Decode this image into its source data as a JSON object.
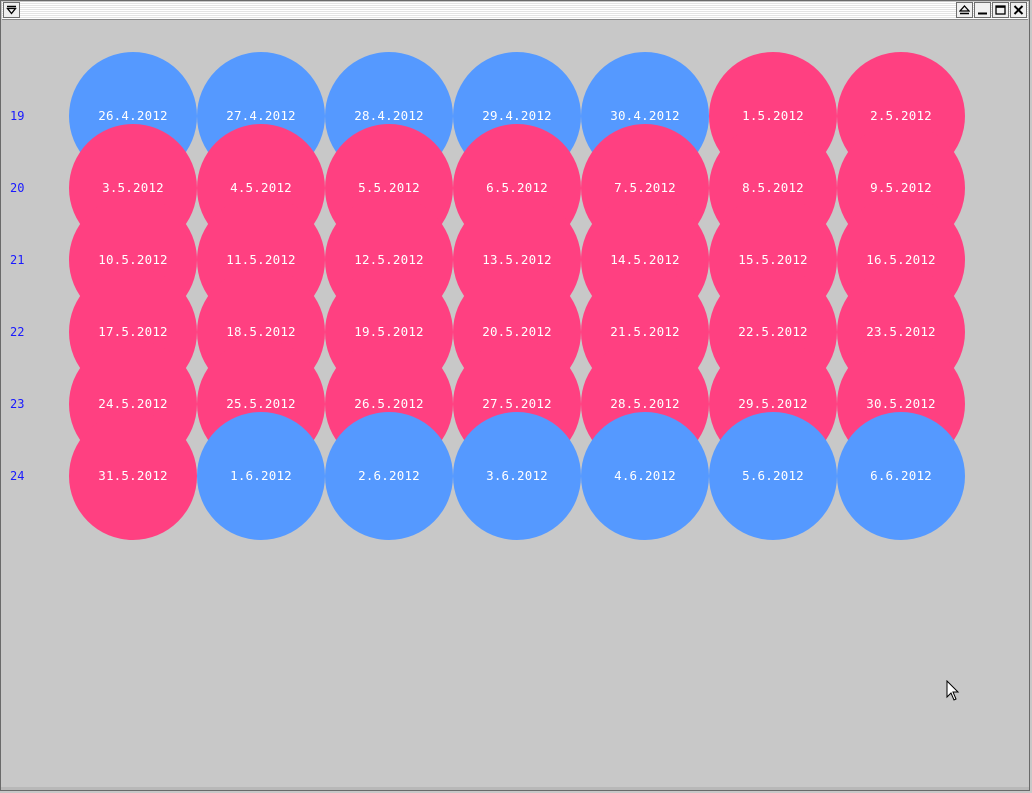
{
  "colors": {
    "workday": "#ff4081",
    "weekend": "#5599ff",
    "week_label": "#1a1aff",
    "background": "#c8c8c8"
  },
  "titlebar": {
    "icons": [
      "window-menu-icon",
      "shade-icon",
      "minimize-icon",
      "maximize-icon",
      "close-icon"
    ]
  },
  "calendar": {
    "weeks": [
      {
        "number": "19",
        "days": [
          {
            "label": "26.4.2012",
            "type": "weekend"
          },
          {
            "label": "27.4.2012",
            "type": "weekend"
          },
          {
            "label": "28.4.2012",
            "type": "weekend"
          },
          {
            "label": "29.4.2012",
            "type": "weekend"
          },
          {
            "label": "30.4.2012",
            "type": "weekend"
          },
          {
            "label": "1.5.2012",
            "type": "workday"
          },
          {
            "label": "2.5.2012",
            "type": "workday"
          }
        ]
      },
      {
        "number": "20",
        "days": [
          {
            "label": "3.5.2012",
            "type": "workday"
          },
          {
            "label": "4.5.2012",
            "type": "workday"
          },
          {
            "label": "5.5.2012",
            "type": "workday"
          },
          {
            "label": "6.5.2012",
            "type": "workday"
          },
          {
            "label": "7.5.2012",
            "type": "workday"
          },
          {
            "label": "8.5.2012",
            "type": "workday"
          },
          {
            "label": "9.5.2012",
            "type": "workday"
          }
        ]
      },
      {
        "number": "21",
        "days": [
          {
            "label": "10.5.2012",
            "type": "workday"
          },
          {
            "label": "11.5.2012",
            "type": "workday"
          },
          {
            "label": "12.5.2012",
            "type": "workday"
          },
          {
            "label": "13.5.2012",
            "type": "workday"
          },
          {
            "label": "14.5.2012",
            "type": "workday"
          },
          {
            "label": "15.5.2012",
            "type": "workday"
          },
          {
            "label": "16.5.2012",
            "type": "workday"
          }
        ]
      },
      {
        "number": "22",
        "days": [
          {
            "label": "17.5.2012",
            "type": "workday"
          },
          {
            "label": "18.5.2012",
            "type": "workday"
          },
          {
            "label": "19.5.2012",
            "type": "workday"
          },
          {
            "label": "20.5.2012",
            "type": "workday"
          },
          {
            "label": "21.5.2012",
            "type": "workday"
          },
          {
            "label": "22.5.2012",
            "type": "workday"
          },
          {
            "label": "23.5.2012",
            "type": "workday"
          }
        ]
      },
      {
        "number": "23",
        "days": [
          {
            "label": "24.5.2012",
            "type": "workday"
          },
          {
            "label": "25.5.2012",
            "type": "workday"
          },
          {
            "label": "26.5.2012",
            "type": "workday"
          },
          {
            "label": "27.5.2012",
            "type": "workday"
          },
          {
            "label": "28.5.2012",
            "type": "workday"
          },
          {
            "label": "29.5.2012",
            "type": "workday"
          },
          {
            "label": "30.5.2012",
            "type": "workday"
          }
        ]
      },
      {
        "number": "24",
        "days": [
          {
            "label": "31.5.2012",
            "type": "workday"
          },
          {
            "label": "1.6.2012",
            "type": "weekend"
          },
          {
            "label": "2.6.2012",
            "type": "weekend"
          },
          {
            "label": "3.6.2012",
            "type": "weekend"
          },
          {
            "label": "4.6.2012",
            "type": "weekend"
          },
          {
            "label": "5.6.2012",
            "type": "weekend"
          },
          {
            "label": "6.6.2012",
            "type": "weekend"
          }
        ]
      }
    ]
  }
}
